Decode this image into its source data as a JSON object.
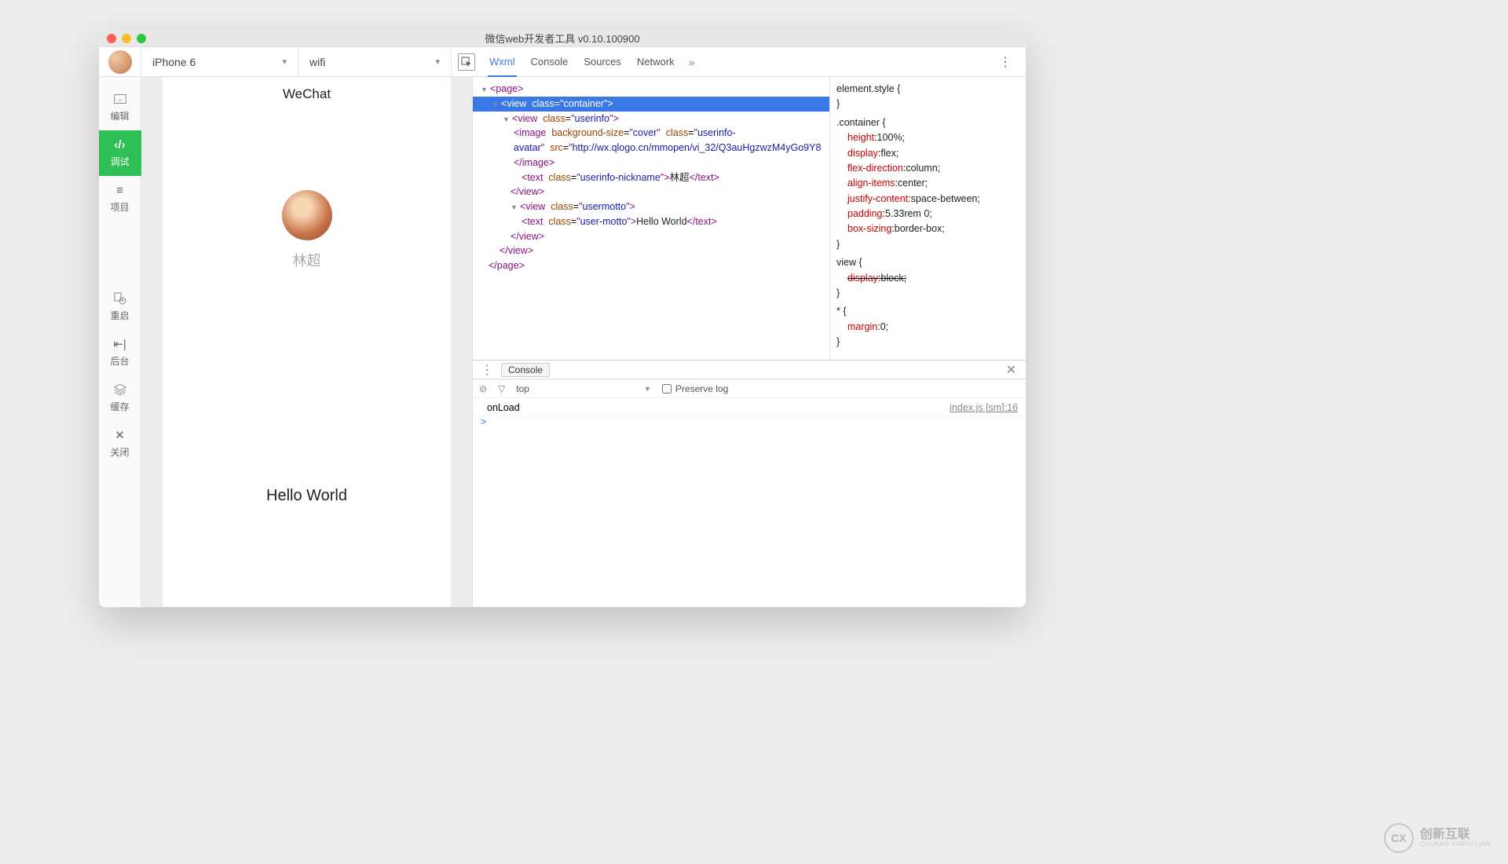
{
  "window": {
    "title": "微信web开发者工具 v0.10.100900"
  },
  "toolbar": {
    "device": "iPhone 6",
    "network": "wifi",
    "devtools_tabs": [
      "Wxml",
      "Console",
      "Sources",
      "Network"
    ],
    "more_glyph": "»",
    "menu_glyph": "⋮"
  },
  "sidenav": {
    "items": [
      {
        "key": "edit",
        "label": "编辑"
      },
      {
        "key": "debug",
        "label": "调试"
      },
      {
        "key": "project",
        "label": "项目"
      },
      {
        "key": "restart",
        "label": "重启"
      },
      {
        "key": "back",
        "label": "后台"
      },
      {
        "key": "cache",
        "label": "缓存"
      },
      {
        "key": "close",
        "label": "关闭"
      }
    ],
    "active": "debug"
  },
  "simulator": {
    "header": "WeChat",
    "nickname": "林超",
    "motto": "Hello World"
  },
  "wxml": {
    "image_src": "http://wx.qlogo.cn/mmopen/vi_32/Q3auHgzwzM4yGo9Y8",
    "nickname_text": "林超",
    "motto_text": "Hello World",
    "container_class": "container",
    "userinfo_class": "userinfo",
    "avatar_class": "userinfo-avatar",
    "nickname_class": "userinfo-nickname",
    "usermotto_class": "usermotto",
    "usermotto_text_class": "user-motto",
    "bg_size": "cover"
  },
  "styles": {
    "element_style": "element.style {",
    "container_sel": ".container {",
    "rules": {
      "height": "100%;",
      "display": "flex;",
      "flex_direction": "column;",
      "align_items": "center;",
      "justify_content": "space-between;",
      "padding": "5.33rem 0;",
      "box_sizing": "border-box;"
    },
    "view_sel": "view {",
    "view_display": "block;",
    "star_sel": "* {",
    "star_margin": "0;"
  },
  "console": {
    "tab_label": "Console",
    "context": "top",
    "preserve_label": "Preserve log",
    "lines": [
      {
        "msg": "onLoad",
        "src": "index.js [sm]:16"
      }
    ],
    "prompt": ">"
  },
  "watermark": {
    "badge": "CX",
    "cn": "创新互联",
    "en": "CHUANG XINHU LIAN"
  }
}
